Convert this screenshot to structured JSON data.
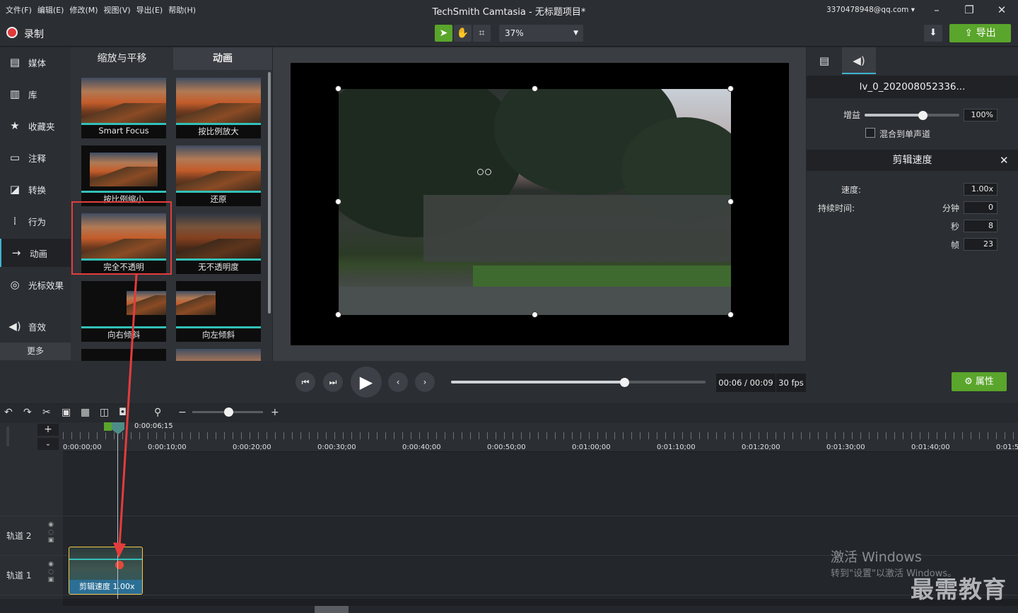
{
  "menu": [
    "文件(F)",
    "编辑(E)",
    "修改(M)",
    "视图(V)",
    "导出(E)",
    "帮助(H)"
  ],
  "window_title": "TechSmith Camtasia - 无标题项目*",
  "account": "3370478948@qq.com",
  "record_label": "录制",
  "zoom": "37%",
  "export_label": "导出",
  "sidebar": [
    "媒体",
    "库",
    "收藏夹",
    "注释",
    "转换",
    "行为",
    "动画",
    "光标效果",
    "音效"
  ],
  "sidebar_more": "更多",
  "tabs": {
    "left": "缩放与平移",
    "right": "动画"
  },
  "thumbs": [
    "Smart Focus",
    "按比例放大",
    "按比例缩小",
    "还原",
    "完全不透明",
    "无不透明度",
    "向右倾斜",
    "向左倾斜"
  ],
  "props": {
    "clip_name": "lv_0_202008052336...",
    "gain_label": "增益",
    "gain_value": "100%",
    "gain_level": 0.62,
    "mix_mono": "混合到单声道",
    "speed_header": "剪辑速度",
    "speed_label": "速度:",
    "speed_value": "1.00x",
    "duration_label": "持续时间:",
    "min_label": "分钟",
    "min_value": "0",
    "sec_label": "秒",
    "sec_value": "8",
    "frame_label": "帧",
    "frame_value": "23"
  },
  "transport": {
    "time": "00:06 / 00:09",
    "fps": "30 fps",
    "props_btn": "属性",
    "progress": 0.68
  },
  "timeline": {
    "playhead_time": "0:00:06;15",
    "ruler": [
      "0:00:00;00",
      "0:00:10;00",
      "0:00:20;00",
      "0:00:30;00",
      "0:00:40;00",
      "0:00:50;00",
      "0:01:00;00",
      "0:01:10;00",
      "0:01:20;00",
      "0:01:30;00",
      "0:01:40;00",
      "0:01:5"
    ],
    "tracks": [
      "轨道 2",
      "轨道 1"
    ],
    "clip_label": "剪辑速度",
    "clip_speed": "1.00x"
  },
  "watermark": {
    "line1": "激活 Windows",
    "line2": "转到\"设置\"以激活 Windows。",
    "logo": "最需教育"
  },
  "colors": {
    "accent_green": "#5aa52b",
    "record_red": "#e03a3a",
    "highlight_red": "#e43c3c",
    "teal": "#33c0b8",
    "clip_border": "#f4c84a"
  }
}
